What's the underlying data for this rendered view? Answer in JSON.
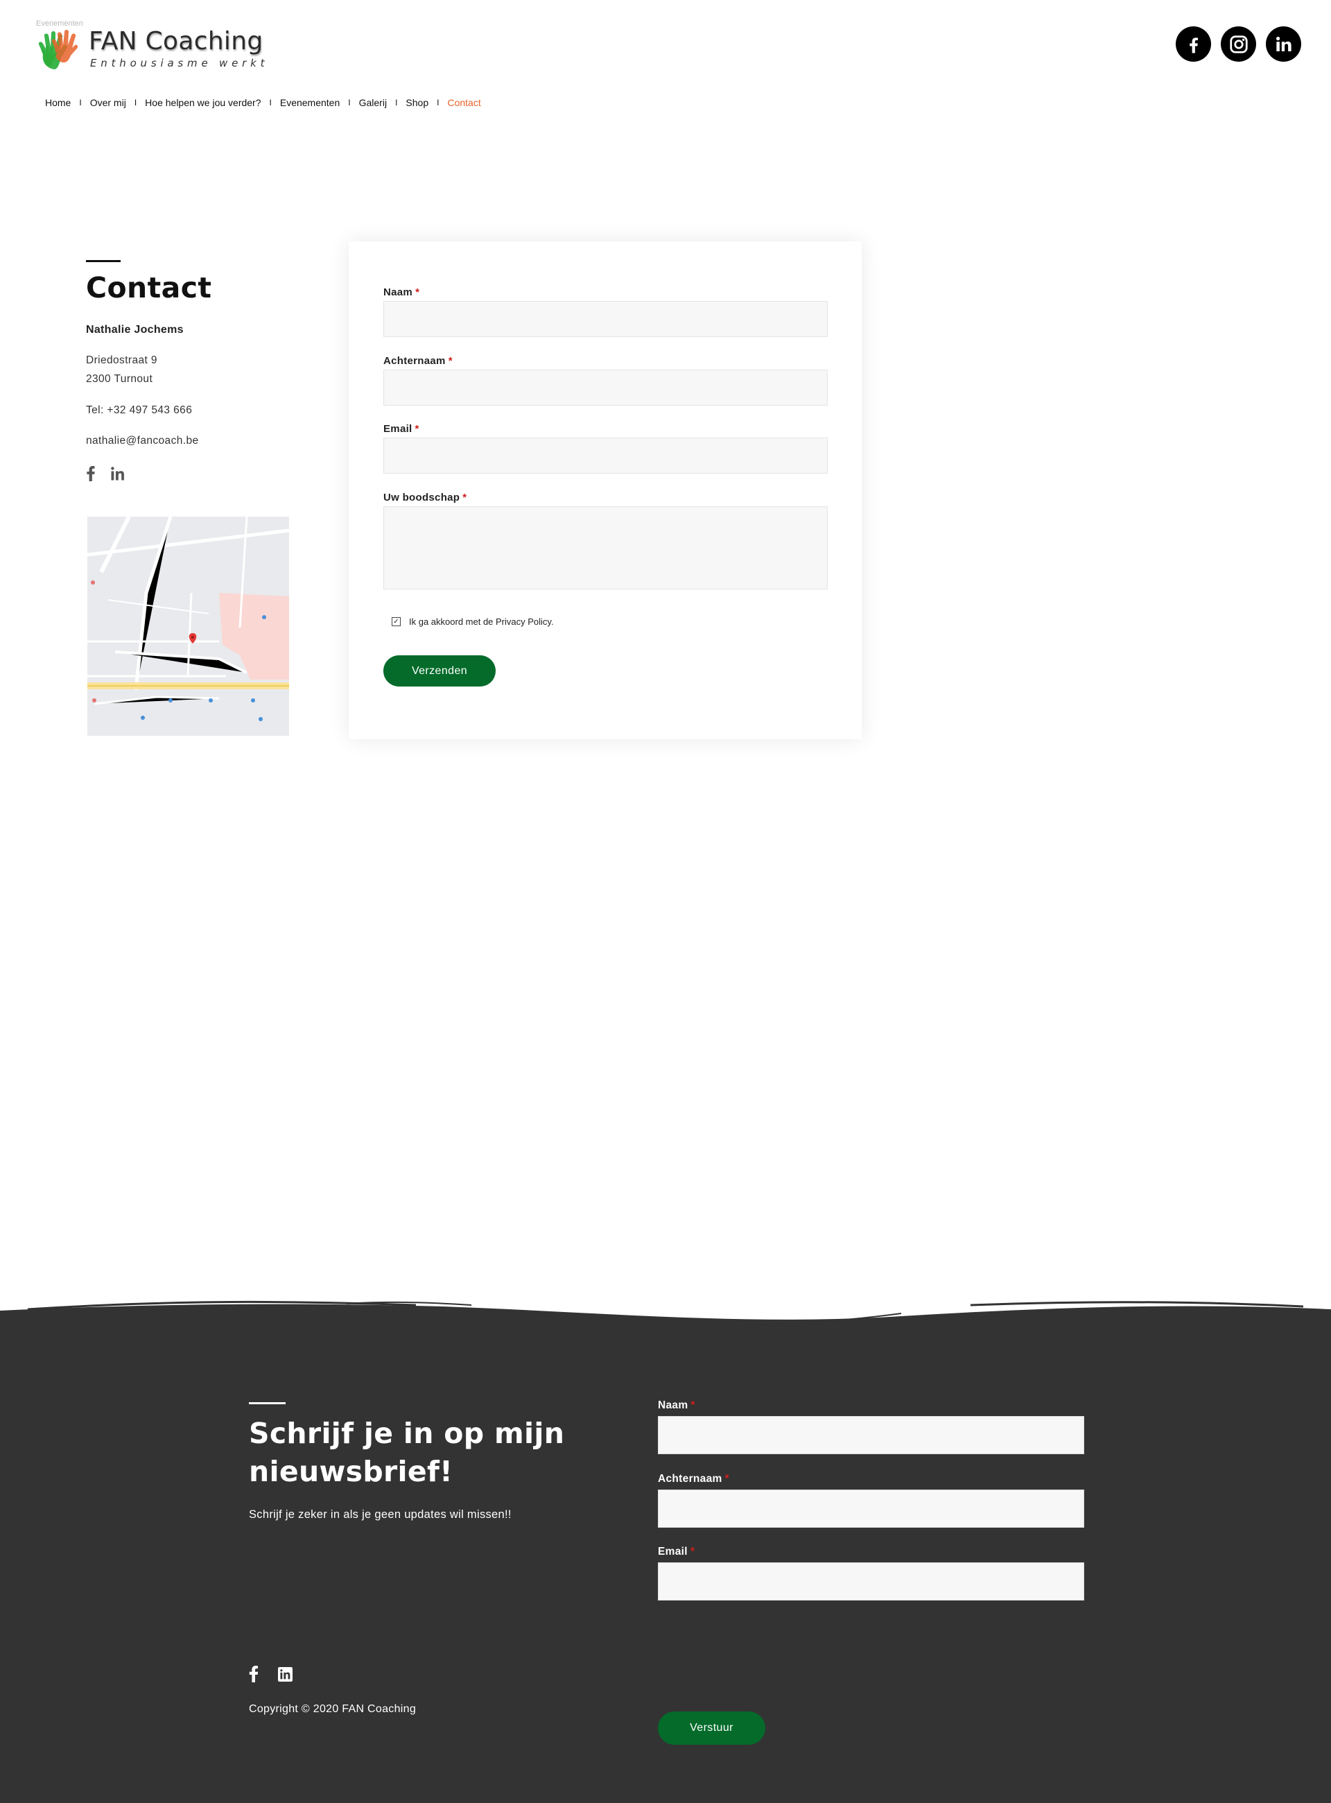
{
  "header": {
    "tiny_text": "Evenementen",
    "logo_title": "FAN Coaching",
    "logo_tagline": "Enthousiasme werkt",
    "social": [
      {
        "icon": "facebook-icon"
      },
      {
        "icon": "instagram-icon"
      },
      {
        "icon": "linkedin-icon"
      }
    ]
  },
  "nav": {
    "items": [
      "Home",
      "Over mij",
      "Hoe helpen we jou verder?",
      "Evenementen",
      "Galerij",
      "Shop",
      "Contact"
    ],
    "separator": "I",
    "active": "Contact",
    "active_color": "#e8632b"
  },
  "contact": {
    "title": "Contact",
    "name": "Nathalie Jochems",
    "street": "Driedostraat 9",
    "city": "2300 Turnout",
    "tel": "Tel: +32 497 543 666",
    "email": "nathalie@fancoach.be",
    "social": [
      {
        "icon": "facebook-icon"
      },
      {
        "icon": "linkedin-icon"
      }
    ]
  },
  "form": {
    "naam_label": "Naam",
    "achternaam_label": "Achternaam",
    "email_label": "Email",
    "message_label": "Uw boodschap",
    "required_mark": "*",
    "naam_value": "",
    "achternaam_value": "",
    "email_value": "",
    "message_value": "",
    "privacy_label": "Ik ga akkoord met de Privacy Policy.",
    "privacy_checked": true,
    "submit_label": "Verzenden"
  },
  "footer": {
    "title": "Schrijf je in op mijn nieuwsbrief!",
    "subtitle": "Schrijf je zeker in als je geen updates wil missen!!",
    "naam_label": "Naam",
    "achternaam_label": "Achternaam",
    "email_label": "Email",
    "required_mark": "*",
    "send_label": "Verstuur",
    "copyright": "Copyright © 2020 FAN Coaching",
    "social": [
      {
        "icon": "facebook-icon"
      },
      {
        "icon": "linkedin-icon"
      }
    ]
  },
  "colors": {
    "accent_green": "#046b2a",
    "footer_bg": "#333333",
    "required_red": "#d01c1c",
    "nav_active": "#e8632b"
  }
}
